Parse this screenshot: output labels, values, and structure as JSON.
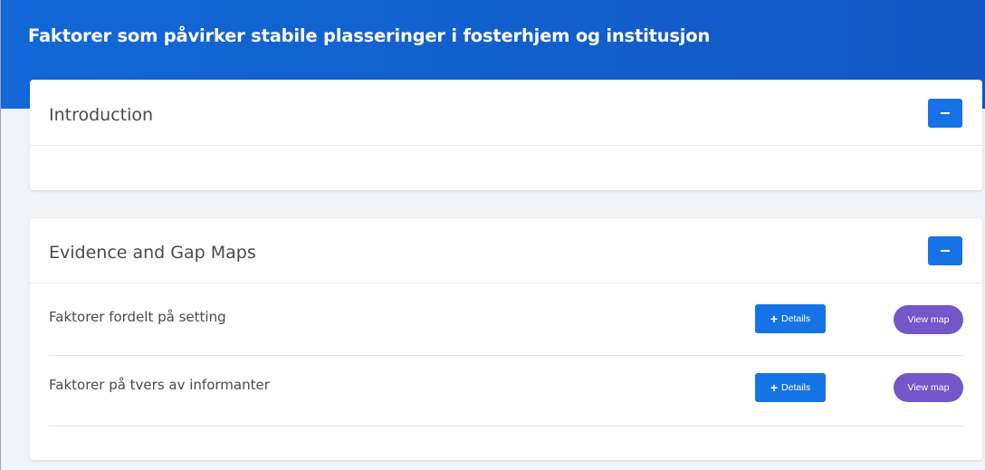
{
  "header": {
    "title": "Faktorer som påvirker stabile plasseringer i fosterhjem og institusjon"
  },
  "sections": {
    "introduction": {
      "title": "Introduction",
      "collapse_icon": "minus-icon"
    },
    "maps": {
      "title": "Evidence and Gap Maps",
      "collapse_icon": "minus-icon",
      "rows": [
        {
          "label": "Faktorer fordelt på setting",
          "details_label": "Details",
          "view_label": "View map"
        },
        {
          "label": "Faktorer på tvers av informanter",
          "details_label": "Details",
          "view_label": "View map"
        }
      ]
    }
  },
  "colors": {
    "header_blue": "#1268d8",
    "button_blue": "#1673e6",
    "view_map_purple": "#7457c8"
  }
}
